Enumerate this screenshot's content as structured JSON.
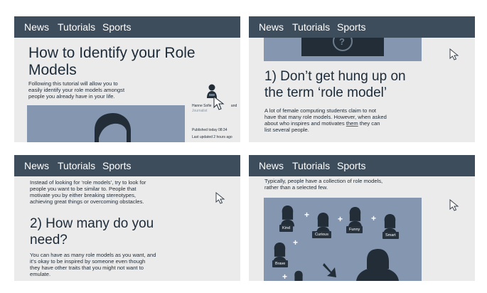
{
  "nav": {
    "news": "News",
    "tutorials": "Tutorials",
    "sports": "Sports"
  },
  "panel1": {
    "title_line1": "How to Identify your Role",
    "title_line2": "Models",
    "intro_line1": "Following this tutorial will allow you to",
    "intro_line2": "easily identify your role models amongst",
    "intro_line3": "people you already have in your life.",
    "author_name": "Hanne Sofie",
    "author_name_tail": "and",
    "author_role": "Journalist",
    "published": "Published today 08:34",
    "updated": "Last updated 2 hours ago"
  },
  "panel2": {
    "question_mark": "?",
    "heading_line1": "1) Don’t get hung up on",
    "heading_line2": "the term ‘role model’",
    "para_line1": "A lot of female computing students claim to not",
    "para_line2": "have that many role models. However, when asked",
    "para_line3_a": "about who inspires and motivates ",
    "para_line3_link": "them",
    "para_line3_b": " they can",
    "para_line4": "list several people."
  },
  "panel3": {
    "intro_line1": "Instead of looking for ‘role models’, try to look for",
    "intro_line2": "people you want to be similar to. People that",
    "intro_line3": "motivate you by either breaking stereotypes,",
    "intro_line4": "achieving great things or overcoming obstacles.",
    "heading_line1": "2) How many do you",
    "heading_line2": "need?",
    "para_line1": "You can have as many role models as you want, and",
    "para_line2": "it’s okay to be inspired by someone even though",
    "para_line3": "they have other traits that you might not want to",
    "para_line4": "emulate."
  },
  "panel4": {
    "intro_line1": "Typically, people have a collection of role models,",
    "intro_line2": "rather than a selected few.",
    "tags": [
      "Kind",
      "Curious",
      "Funny",
      "Smart",
      "Brave"
    ],
    "plus": "+"
  },
  "colors": {
    "navbar": "#3e4d5c",
    "panel_bg": "#ebebeb",
    "image_blue": "#8597b0",
    "silhouette": "#222d38"
  }
}
